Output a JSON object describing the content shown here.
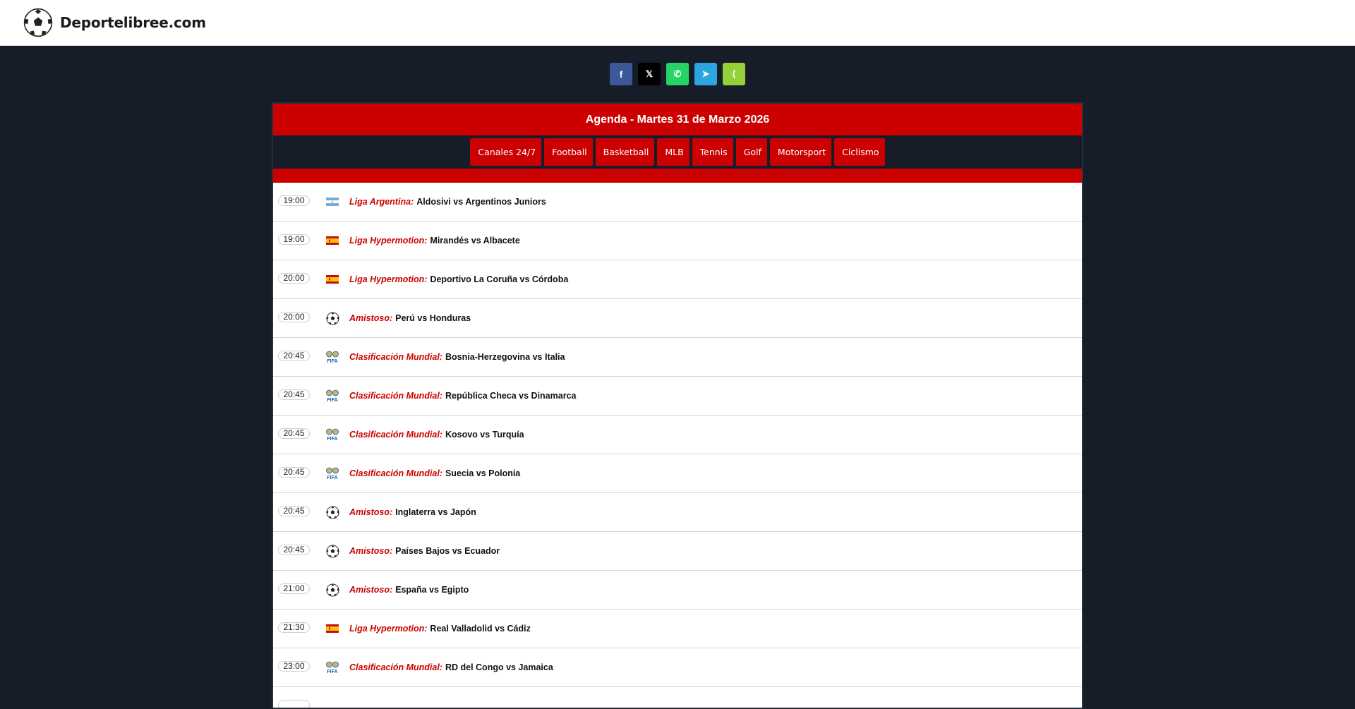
{
  "site": {
    "name": "Deportelibree.com",
    "logo_icon": "soccer-ball-icon"
  },
  "share_buttons": [
    {
      "label": "f",
      "icon": "facebook-icon",
      "color": "#3b5998"
    },
    {
      "label": "𝕏",
      "icon": "x-icon",
      "color": "#000000"
    },
    {
      "label": "✆",
      "icon": "whatsapp-icon",
      "color": "#25d366"
    },
    {
      "label": "➤",
      "icon": "telegram-icon",
      "color": "#2ca5e0"
    },
    {
      "label": "⟨",
      "icon": "share-icon",
      "color": "#95d03a"
    }
  ],
  "agenda": {
    "title": "Agenda - Martes 31 de Marzo 2026"
  },
  "categories": [
    {
      "glyph": "",
      "label": "Canales 24/7"
    },
    {
      "glyph": "",
      "label": "Football"
    },
    {
      "glyph": "",
      "label": "Basketball"
    },
    {
      "glyph": "",
      "label": "MLB"
    },
    {
      "glyph": "",
      "label": "Tennis"
    },
    {
      "glyph": "",
      "label": "Golf"
    },
    {
      "glyph": "",
      "label": "Motorsport"
    },
    {
      "glyph": "",
      "label": "Ciclismo"
    }
  ],
  "events": [
    {
      "time": "19:00",
      "icon": "argentina-flag-icon",
      "league": "Liga Argentina:",
      "match": "Aldosivi vs Argentinos Juniors"
    },
    {
      "time": "19:00",
      "icon": "spain-flag-icon",
      "league": "Liga Hypermotion:",
      "match": "Mirandés vs Albacete"
    },
    {
      "time": "20:00",
      "icon": "spain-flag-icon",
      "league": "Liga Hypermotion:",
      "match": "Deportivo La Coruña vs Córdoba"
    },
    {
      "time": "20:00",
      "icon": "soccer-ball-icon",
      "league": "Amistoso:",
      "match": "Perú vs Honduras"
    },
    {
      "time": "20:45",
      "icon": "fifa-logo-icon",
      "league": "Clasificación Mundial:",
      "match": "Bosnia-Herzegovina vs Italia"
    },
    {
      "time": "20:45",
      "icon": "fifa-logo-icon",
      "league": "Clasificación Mundial:",
      "match": "República Checa vs Dinamarca"
    },
    {
      "time": "20:45",
      "icon": "fifa-logo-icon",
      "league": "Clasificación Mundial:",
      "match": "Kosovo vs Turquía"
    },
    {
      "time": "20:45",
      "icon": "fifa-logo-icon",
      "league": "Clasificación Mundial:",
      "match": "Suecia vs Polonia"
    },
    {
      "time": "20:45",
      "icon": "soccer-ball-icon",
      "league": "Amistoso:",
      "match": "Inglaterra vs Japón"
    },
    {
      "time": "20:45",
      "icon": "soccer-ball-icon",
      "league": "Amistoso:",
      "match": "Países Bajos vs Ecuador"
    },
    {
      "time": "21:00",
      "icon": "soccer-ball-icon",
      "league": "Amistoso:",
      "match": "España vs Egipto"
    },
    {
      "time": "21:30",
      "icon": "spain-flag-icon",
      "league": "Liga Hypermotion:",
      "match": "Real Valladolid vs Cádiz"
    },
    {
      "time": "23:00",
      "icon": "fifa-logo-icon",
      "league": "Clasificación Mundial:",
      "match": "RD del Congo vs Jamaica"
    },
    {
      "time": "",
      "icon": "",
      "league": "",
      "match": ""
    }
  ]
}
